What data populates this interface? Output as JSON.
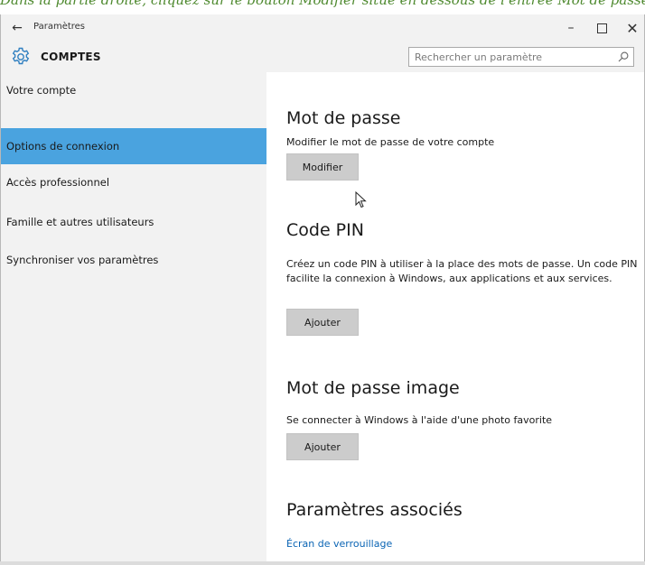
{
  "caption": "Dans la partie droite, cliquez sur le bouton Modifier situé en dessous de l'entrée Mot de passe",
  "window": {
    "app_title": "Paramètres",
    "back_glyph": "←",
    "minimize_glyph": "–",
    "close_glyph": "✕"
  },
  "header": {
    "section_title": "COMPTES",
    "icon": "gear-icon",
    "search_placeholder": "Rechercher un paramètre",
    "search_value": ""
  },
  "sidebar": {
    "items": [
      {
        "label": "Votre compte",
        "selected": false
      },
      {
        "label": "Options de connexion",
        "selected": true
      },
      {
        "label": "Accès professionnel",
        "selected": false
      },
      {
        "label": "Famille et autres utilisateurs",
        "selected": false
      },
      {
        "label": "Synchroniser vos paramètres",
        "selected": false
      }
    ]
  },
  "content": {
    "password": {
      "heading": "Mot de passe",
      "description": "Modifier le mot de passe de votre compte",
      "button": "Modifier"
    },
    "pin": {
      "heading": "Code PIN",
      "description": "Créez un code PIN à utiliser à la place des mots de passe. Un code PIN facilite la connexion à Windows, aux applications et aux services.",
      "button": "Ajouter"
    },
    "picture_password": {
      "heading": "Mot de passe image",
      "description": "Se connecter à Windows à l'aide d'une photo favorite",
      "button": "Ajouter"
    },
    "related": {
      "heading": "Paramètres associés",
      "link": "Écran de verrouillage"
    }
  },
  "colors": {
    "selected_nav": "#4aa3df",
    "link": "#0a64b4",
    "gear": "#2f7fc0",
    "button": "#cccccc",
    "sidebar_bg": "#f2f2f2"
  }
}
